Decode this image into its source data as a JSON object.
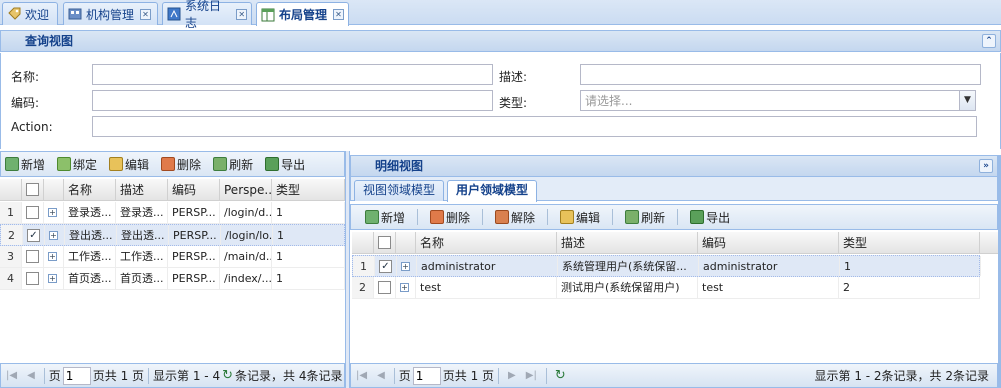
{
  "tabs": [
    {
      "label": "欢迎",
      "icon": "tag-icon",
      "closable": false,
      "active": false
    },
    {
      "label": "机构管理",
      "icon": "org-icon",
      "closable": true,
      "active": false
    },
    {
      "label": "系统日志",
      "icon": "log-icon",
      "closable": true,
      "active": false
    },
    {
      "label": "布局管理",
      "icon": "layout-icon",
      "closable": true,
      "active": true
    }
  ],
  "close_glyph": "✕",
  "query": {
    "title": "查询视图",
    "collapse_glyph": "⌃",
    "fields": {
      "name_label": "名称:",
      "name_value": "",
      "desc_label": "描述:",
      "desc_value": "",
      "code_label": "编码:",
      "code_value": "",
      "type_label": "类型:",
      "type_placeholder": "请选择...",
      "action_label": "Action:",
      "action_value": ""
    }
  },
  "left_toolbar": [
    "新增",
    "绑定",
    "编辑",
    "删除",
    "刷新",
    "导出"
  ],
  "left_grid": {
    "columns": [
      "名称",
      "描述",
      "编码",
      "Perspe...",
      "类型"
    ],
    "rows": [
      {
        "num": "1",
        "checked": false,
        "name": "登录透...",
        "desc": "登录透...",
        "code": "PERSP...",
        "persp": "/login/d...",
        "type": "1",
        "selected": false
      },
      {
        "num": "2",
        "checked": true,
        "name": "登出透...",
        "desc": "登出透...",
        "code": "PERSP...",
        "persp": "/login/lo...",
        "type": "1",
        "selected": true
      },
      {
        "num": "3",
        "checked": false,
        "name": "工作透...",
        "desc": "工作透...",
        "code": "PERSP...",
        "persp": "/main/d...",
        "type": "1",
        "selected": false
      },
      {
        "num": "4",
        "checked": false,
        "name": "首页透...",
        "desc": "首页透...",
        "code": "PERSP...",
        "persp": "/index/...",
        "type": "1",
        "selected": false
      }
    ]
  },
  "left_pager": {
    "page_prefix": "页",
    "page_value": "1",
    "page_suffix": "页共 1 页",
    "status_a": "显示第 1 - 4",
    "status_b": "条记录，共 4条记录"
  },
  "detail": {
    "title": "明细视图",
    "expand_glyph": "»",
    "tabs": [
      "视图领域模型",
      "用户领域模型"
    ],
    "toolbar": [
      "新增",
      "删除",
      "解除",
      "编辑",
      "刷新",
      "导出"
    ],
    "columns": [
      "名称",
      "描述",
      "编码",
      "类型"
    ],
    "rows": [
      {
        "num": "1",
        "checked": true,
        "name": "administrator",
        "desc": "系统管理用户(系统保留...",
        "code": "administrator",
        "type": "1",
        "selected": true
      },
      {
        "num": "2",
        "checked": false,
        "name": "test",
        "desc": "测试用户(系统保留用户)",
        "code": "test",
        "type": "2",
        "selected": false
      }
    ],
    "pager": {
      "page_prefix": "页",
      "page_value": "1",
      "page_suffix": "页共 1 页",
      "status": "显示第 1 - 2条记录，共 2条记录"
    }
  },
  "nav_glyphs": {
    "first": "|◀",
    "prev": "◀",
    "next": "▶",
    "last": "▶|",
    "refresh": "↻"
  },
  "check_glyph": "✓",
  "expand_row_glyph": "+"
}
